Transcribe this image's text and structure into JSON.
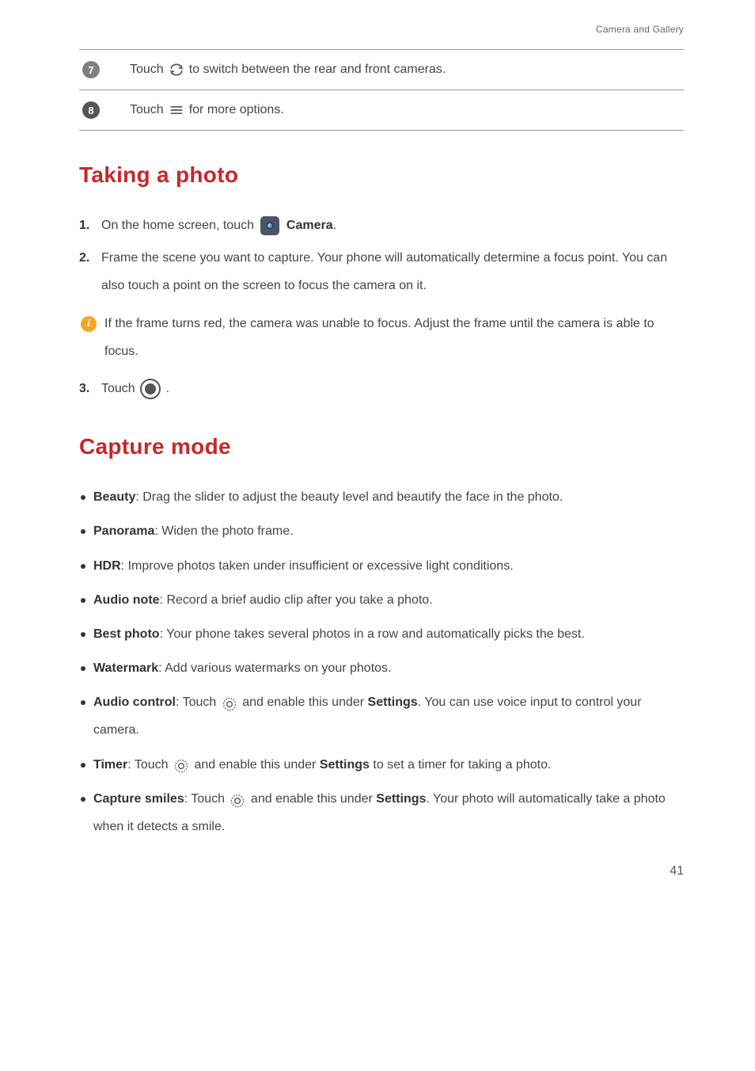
{
  "header": {
    "breadcrumb": "Camera and Gallery"
  },
  "table": {
    "row7": {
      "num": "7",
      "pre": "Touch ",
      "post": "to switch between the rear and front cameras."
    },
    "row8": {
      "num": "8",
      "pre": "Touch ",
      "post": "for more options."
    }
  },
  "sections": {
    "taking_photo": {
      "title": "Taking a photo",
      "step1": {
        "num": "1.",
        "pre": "On the home screen, touch ",
        "label": "Camera",
        "post": "."
      },
      "step2": {
        "num": "2.",
        "text": "Frame the scene you want to capture. Your phone will automatically determine a focus point. You can also touch a point on the screen to focus the camera on it."
      },
      "info": "If the frame turns red, the camera was unable to focus. Adjust the frame until the camera is able to focus.",
      "step3": {
        "num": "3.",
        "pre": "Touch ",
        "post": " ."
      }
    },
    "capture_mode": {
      "title": "Capture mode",
      "items": [
        {
          "label": "Beauty",
          "text": ": Drag the slider to adjust the beauty level and beautify the face in the photo."
        },
        {
          "label": "Panorama",
          "text": ": Widen the photo frame."
        },
        {
          "label": "HDR",
          "text": ": Improve photos taken under insufficient or excessive light conditions."
        },
        {
          "label": "Audio note",
          "text": ": Record a brief audio clip after you take a photo."
        },
        {
          "label": "Best photo",
          "text": ": Your phone takes several photos in a row and automatically picks the best."
        },
        {
          "label": "Watermark",
          "text": ": Add various watermarks on your photos."
        }
      ],
      "audio_control": {
        "label": "Audio control",
        "pre": ": Touch ",
        "mid": " and enable this under ",
        "settings": "Settings",
        "post": ". You can use voice input to control your camera."
      },
      "timer": {
        "label": "Timer",
        "pre": ": Touch ",
        "mid": " and enable this under ",
        "settings": "Settings",
        "post": " to set a timer for taking a photo."
      },
      "smiles": {
        "label": "Capture smiles",
        "pre": ": Touch ",
        "mid": " and enable this under ",
        "settings": "Settings",
        "post": ". Your photo will automatically take a photo when it detects a smile."
      }
    }
  },
  "page_number": "41"
}
